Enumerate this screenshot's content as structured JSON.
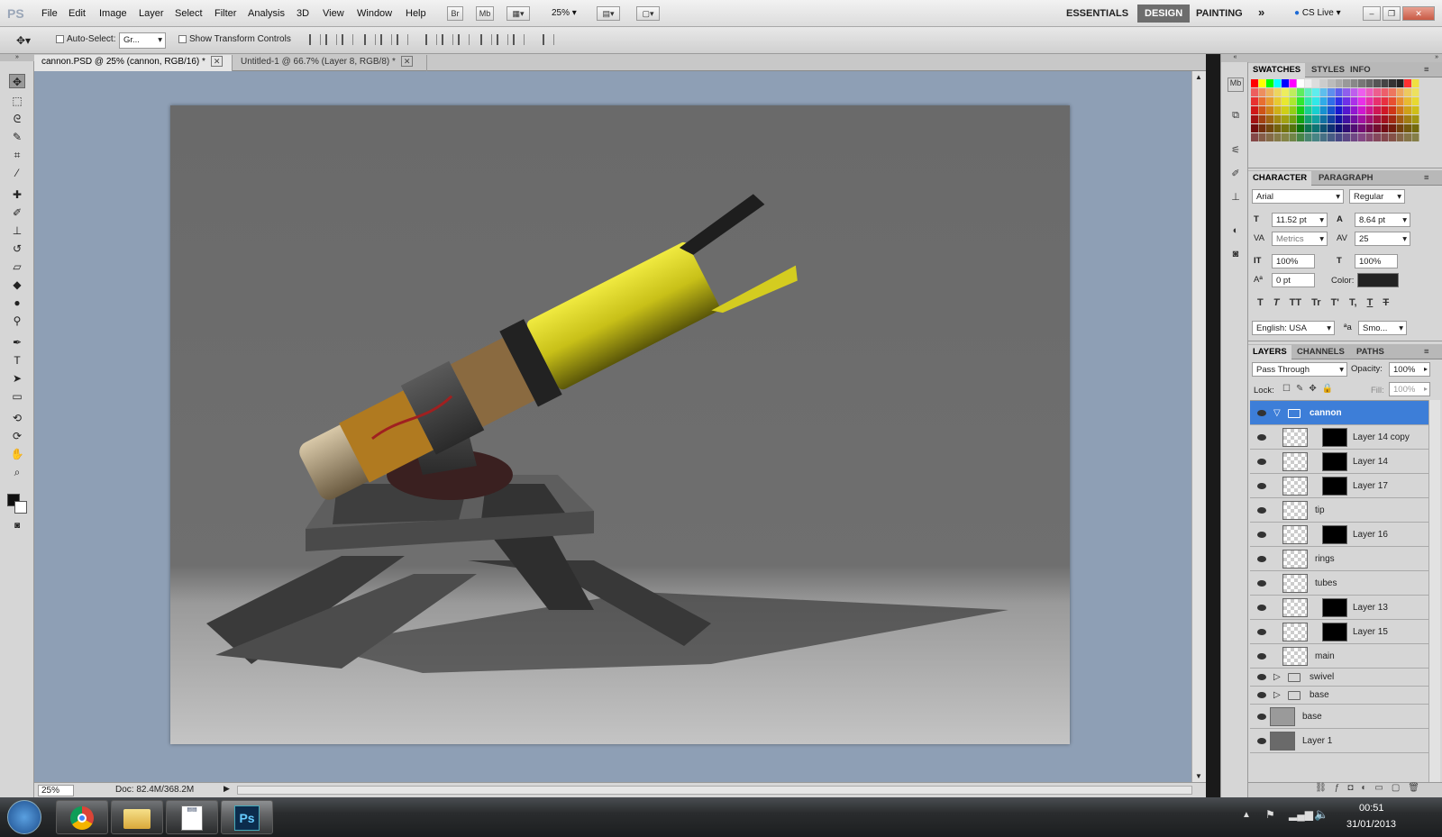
{
  "app": {
    "logo": "PS"
  },
  "menu": [
    "File",
    "Edit",
    "Image",
    "Layer",
    "Select",
    "Filter",
    "Analysis",
    "3D",
    "View",
    "Window",
    "Help"
  ],
  "appbar": {
    "br": "Br",
    "mb": "Mb",
    "zoom": "25%"
  },
  "workspaces": {
    "essentials": "ESSENTIALS",
    "design": "DESIGN",
    "painting": "PAINTING",
    "more": "»",
    "cslive": "CS Live"
  },
  "options": {
    "auto_select_label": "Auto-Select:",
    "auto_select_value": "Gr...",
    "show_transform": "Show Transform Controls"
  },
  "doc_tabs": [
    {
      "label": "cannon.PSD @ 25% (cannon, RGB/16) *"
    },
    {
      "label": "Untitled-1 @ 66.7% (Layer 8, RGB/8) *"
    }
  ],
  "status": {
    "zoom": "25%",
    "doc": "Doc: 82.4M/368.2M"
  },
  "swatches_panel": {
    "tabs": [
      "SWATCHES",
      "STYLES",
      "INFO"
    ]
  },
  "character_panel": {
    "tabs": [
      "CHARACTER",
      "PARAGRAPH"
    ],
    "font": "Arial",
    "style": "Regular",
    "size": "11.52 pt",
    "leading": "8.64 pt",
    "kerning": "Metrics",
    "tracking": "25",
    "vscale": "100%",
    "hscale": "100%",
    "baseline": "0 pt",
    "color_label": "Color:",
    "language": "English: USA",
    "aa": "Smo...",
    "glyph_buttons": [
      "T",
      "T",
      "TT",
      "Tr",
      "T'",
      "T,",
      "T",
      "T"
    ]
  },
  "layers_panel": {
    "tabs": [
      "LAYERS",
      "CHANNELS",
      "PATHS"
    ],
    "blend": "Pass Through",
    "opacity_label": "Opacity:",
    "opacity": "100%",
    "lock_label": "Lock:",
    "fill_label": "Fill:",
    "fill": "100%",
    "layers": [
      {
        "name": "cannon",
        "type": "group-open"
      },
      {
        "name": "Layer 14 copy",
        "type": "masked"
      },
      {
        "name": "Layer 14",
        "type": "masked"
      },
      {
        "name": "Layer 17",
        "type": "masked"
      },
      {
        "name": "tip",
        "type": "plain"
      },
      {
        "name": "Layer 16",
        "type": "masked"
      },
      {
        "name": "rings",
        "type": "plain"
      },
      {
        "name": "tubes",
        "type": "plain"
      },
      {
        "name": "Layer 13",
        "type": "masked"
      },
      {
        "name": "Layer 15",
        "type": "masked"
      },
      {
        "name": "main",
        "type": "plain"
      },
      {
        "name": "swivel",
        "type": "group"
      },
      {
        "name": "base",
        "type": "group"
      },
      {
        "name": "base",
        "type": "image"
      },
      {
        "name": "Layer 1",
        "type": "fill"
      }
    ]
  },
  "taskbar": {
    "time": "00:51",
    "date": "31/01/2013",
    "ps": "Ps"
  },
  "colors": {
    "selection": "#3d7ed8",
    "canvas_bg": "#8e9fb5",
    "cannon_yellow": "#d6d020"
  }
}
